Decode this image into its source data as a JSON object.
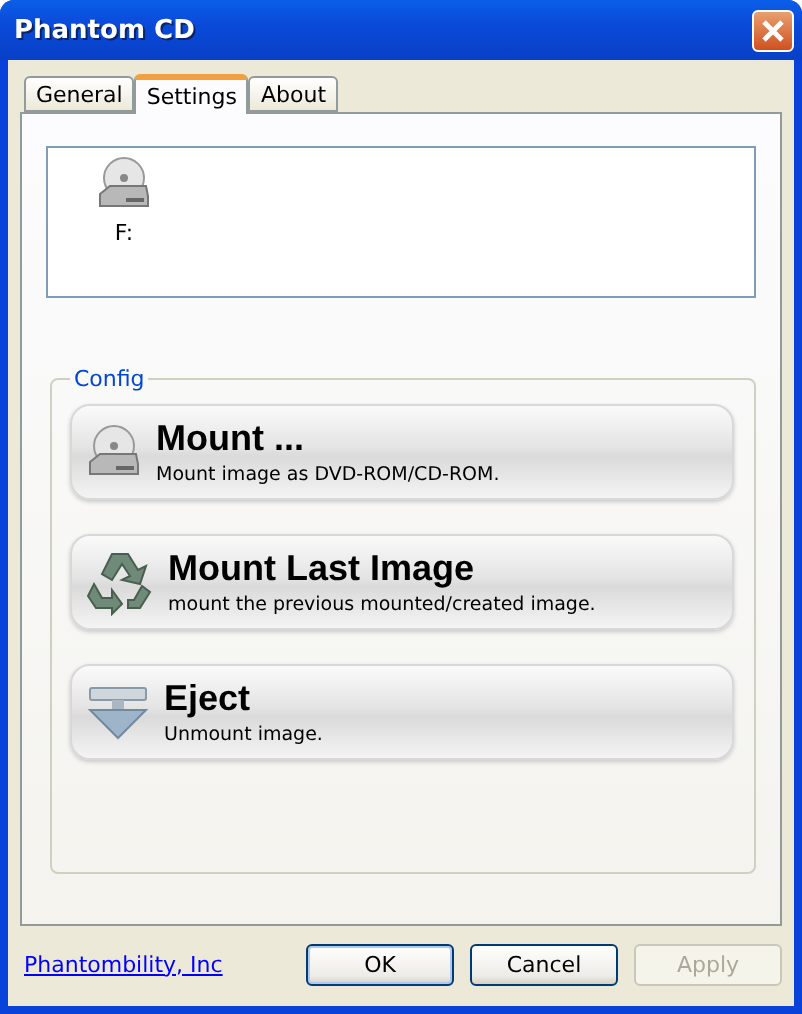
{
  "window": {
    "title": "Phantom CD"
  },
  "tabs": [
    {
      "label": "General",
      "selected": false
    },
    {
      "label": "Settings",
      "selected": true
    },
    {
      "label": "About",
      "selected": false
    }
  ],
  "drives": [
    {
      "label": "F:"
    }
  ],
  "config": {
    "title": "Config",
    "actions": [
      {
        "kind": "mount",
        "title": "Mount ...",
        "description": "Mount image as DVD-ROM/CD-ROM."
      },
      {
        "kind": "recent",
        "title": "Mount Last Image",
        "description": "mount the previous mounted/created image."
      },
      {
        "kind": "eject",
        "title": "Eject",
        "description": "Unmount image."
      }
    ]
  },
  "footer": {
    "link": "Phantombility, Inc",
    "buttons": [
      {
        "label": "OK",
        "disabled": false,
        "default": true
      },
      {
        "label": "Cancel",
        "disabled": false,
        "default": false
      },
      {
        "label": "Apply",
        "disabled": true,
        "default": false
      }
    ]
  }
}
